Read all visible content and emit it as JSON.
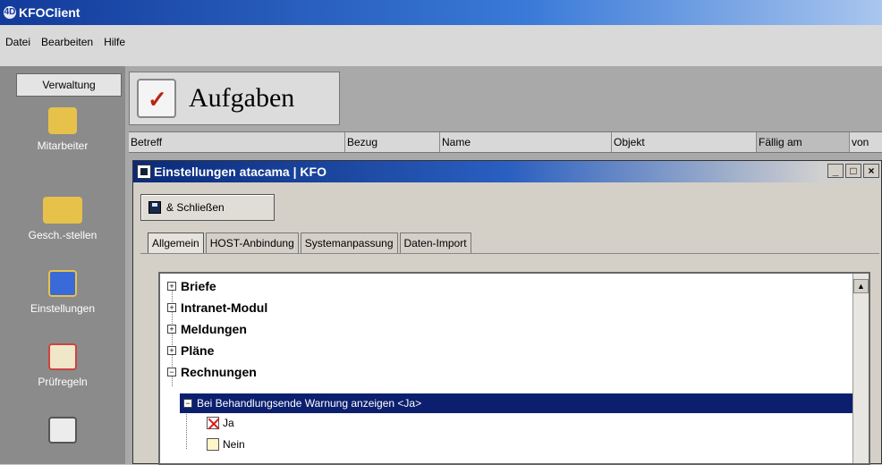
{
  "window": {
    "title": "KFOClient"
  },
  "menu": {
    "items": [
      "Datei",
      "Bearbeiten",
      "Hilfe"
    ]
  },
  "sidebar": {
    "header": "Verwaltung",
    "items": [
      {
        "label": "Mitarbeiter",
        "icon": "employee-icon"
      },
      {
        "label": "Gesch.-stellen",
        "icon": "branches-icon"
      },
      {
        "label": "Einstellungen",
        "icon": "kfo-settings-icon"
      },
      {
        "label": "Prüfregeln",
        "icon": "rules-icon"
      },
      {
        "label": "",
        "icon": "keyboard-icon"
      }
    ]
  },
  "main": {
    "title": "Aufgaben",
    "columns": [
      "Betreff",
      "Bezug",
      "Name",
      "Objekt",
      "Fällig am",
      "von"
    ]
  },
  "dialog": {
    "title": "Einstellungen atacama | KFO",
    "save_button": "& Schließen",
    "tabs": [
      "Allgemein",
      "HOST-Anbindung",
      "Systemanpassung",
      "Daten-Import"
    ],
    "active_tab": "Allgemein",
    "tree": [
      {
        "label": "Briefe",
        "expanded": false
      },
      {
        "label": "Intranet-Modul",
        "expanded": false
      },
      {
        "label": "Meldungen",
        "expanded": false
      },
      {
        "label": "Pläne",
        "expanded": false
      },
      {
        "label": "Rechnungen",
        "expanded": true
      }
    ],
    "selected_setting": "Bei Behandlungsende Warnung anzeigen <Ja>",
    "options": [
      {
        "label": "Ja",
        "checked": true
      },
      {
        "label": "Nein",
        "checked": false
      }
    ]
  }
}
